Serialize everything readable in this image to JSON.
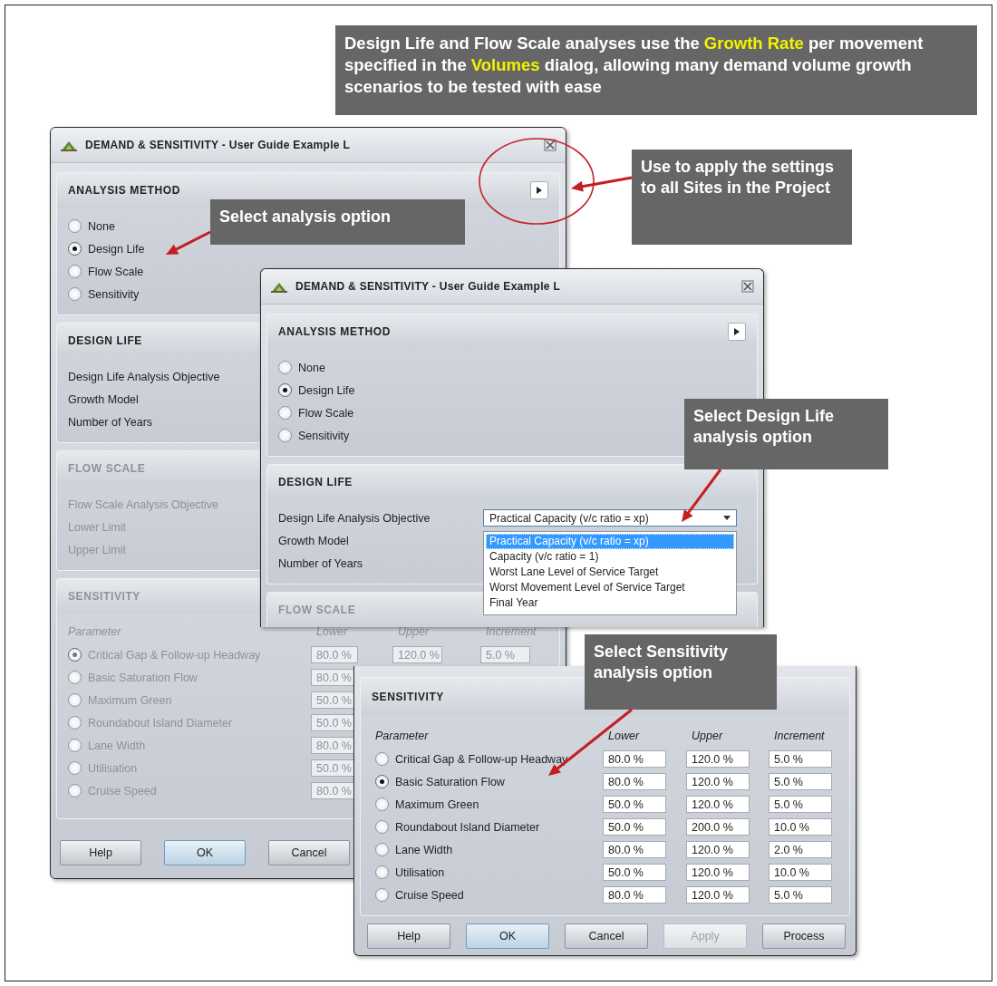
{
  "note_banner": {
    "segments": [
      {
        "text": "Design Life and Flow Scale analyses use the ",
        "highlight": false
      },
      {
        "text": "Growth Rate",
        "highlight": true
      },
      {
        "text": " per movement specified in the ",
        "highlight": false
      },
      {
        "text": "Volumes",
        "highlight": true
      },
      {
        "text": " dialog, allowing many demand volume growth scenarios to be tested with ease",
        "highlight": false
      }
    ]
  },
  "back_dialog": {
    "title": "DEMAND & SENSITIVITY - User Guide Example L",
    "sections": [
      {
        "kind": "radio",
        "heading": "ANALYSIS METHOD",
        "disabled": false,
        "options": [
          {
            "label": "None",
            "selected": false
          },
          {
            "label": "Design Life",
            "selected": true
          },
          {
            "label": "Flow Scale",
            "selected": false
          },
          {
            "label": "Sensitivity",
            "selected": false
          }
        ]
      },
      {
        "kind": "fields",
        "heading": "DESIGN LIFE",
        "disabled": false,
        "fields": [
          "Design Life Analysis Objective",
          "Growth Model",
          "Number of Years"
        ]
      },
      {
        "kind": "fields",
        "heading": "FLOW SCALE",
        "disabled": true,
        "fields": [
          "Flow Scale Analysis Objective",
          "Lower Limit",
          "Upper Limit"
        ]
      },
      {
        "kind": "table",
        "heading": "SENSITIVITY",
        "disabled": true,
        "columns": [
          "Parameter",
          "Lower",
          "Upper",
          "Increment"
        ],
        "rows": [
          {
            "parameter": "Critical Gap & Follow-up Headway",
            "selected": true,
            "lower": "80.0 %",
            "upper": "120.0 %",
            "increment": "5.0 %"
          },
          {
            "parameter": "Basic Saturation Flow",
            "selected": false,
            "lower": "80.0 %"
          },
          {
            "parameter": "Maximum Green",
            "selected": false,
            "lower": "50.0 %"
          },
          {
            "parameter": "Roundabout Island Diameter",
            "selected": false,
            "lower": "50.0 %"
          },
          {
            "parameter": "Lane Width",
            "selected": false,
            "lower": "80.0 %"
          },
          {
            "parameter": "Utilisation",
            "selected": false,
            "lower": "50.0 %"
          },
          {
            "parameter": "Cruise Speed",
            "selected": false,
            "lower": "80.0 %"
          }
        ]
      }
    ],
    "buttons": [
      {
        "label": "Help",
        "default": false,
        "disabled": false
      },
      {
        "label": "OK",
        "default": true,
        "disabled": false
      },
      {
        "label": "Cancel",
        "default": false,
        "disabled": false
      }
    ]
  },
  "middle_dialog": {
    "title": "DEMAND & SENSITIVITY - User Guide Example L",
    "sections": [
      {
        "kind": "radio",
        "heading": "ANALYSIS METHOD",
        "disabled": false,
        "options": [
          {
            "label": "None",
            "selected": false
          },
          {
            "label": "Design Life",
            "selected": true
          },
          {
            "label": "Flow Scale",
            "selected": false
          },
          {
            "label": "Sensitivity",
            "selected": false
          }
        ]
      },
      {
        "kind": "fields",
        "heading": "DESIGN LIFE",
        "disabled": false,
        "fields": [
          "Design Life Analysis Objective",
          "Growth Model",
          "Number of Years"
        ],
        "dropdown": {
          "value": "Practical Capacity (v/c ratio = xp)",
          "expanded": true,
          "options": [
            {
              "label": "Practical Capacity (v/c ratio = xp)",
              "selected": true
            },
            {
              "label": "Capacity (v/c ratio = 1)",
              "selected": false
            },
            {
              "label": "Worst Lane Level of Service Target",
              "selected": false
            },
            {
              "label": "Worst Movement Level of Service Target",
              "selected": false
            },
            {
              "label": "Final Year",
              "selected": false
            }
          ]
        }
      },
      {
        "kind": "fields",
        "heading": "FLOW SCALE",
        "disabled": true
      }
    ]
  },
  "front_dialog": {
    "sections": [
      {
        "kind": "table",
        "heading": "SENSITIVITY",
        "disabled": false,
        "columns": [
          "Parameter",
          "Lower",
          "Upper",
          "Increment"
        ],
        "rows": [
          {
            "parameter": "Critical Gap & Follow-up Headway",
            "selected": false,
            "lower": "80.0 %",
            "upper": "120.0 %",
            "increment": "5.0 %"
          },
          {
            "parameter": "Basic Saturation Flow",
            "selected": true,
            "lower": "80.0 %",
            "upper": "120.0 %",
            "increment": "5.0 %"
          },
          {
            "parameter": "Maximum Green",
            "selected": false,
            "lower": "50.0 %",
            "upper": "120.0 %",
            "increment": "5.0 %"
          },
          {
            "parameter": "Roundabout Island Diameter",
            "selected": false,
            "lower": "50.0 %",
            "upper": "200.0 %",
            "increment": "10.0 %"
          },
          {
            "parameter": "Lane Width",
            "selected": false,
            "lower": "80.0 %",
            "upper": "120.0 %",
            "increment": "2.0 %"
          },
          {
            "parameter": "Utilisation",
            "selected": false,
            "lower": "50.0 %",
            "upper": "120.0 %",
            "increment": "10.0 %"
          },
          {
            "parameter": "Cruise Speed",
            "selected": false,
            "lower": "80.0 %",
            "upper": "120.0 %",
            "increment": "5.0 %"
          }
        ]
      }
    ],
    "buttons": [
      {
        "label": "Help",
        "default": false,
        "disabled": false
      },
      {
        "label": "OK",
        "default": true,
        "disabled": false
      },
      {
        "label": "Cancel",
        "default": false,
        "disabled": false
      },
      {
        "label": "Apply",
        "default": false,
        "disabled": true
      },
      {
        "label": "Process",
        "default": false,
        "disabled": false
      }
    ]
  },
  "callouts": [
    {
      "text": "Use to apply the settings to all Sites in the Project"
    },
    {
      "text": "Select analysis option"
    },
    {
      "text": "Select Design Life analysis option"
    },
    {
      "text": "Select Sensitivity analysis option"
    }
  ]
}
